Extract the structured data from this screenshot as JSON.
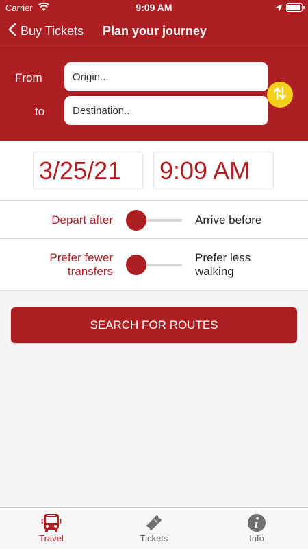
{
  "status_bar": {
    "carrier": "Carrier",
    "time": "9:09 AM"
  },
  "nav": {
    "back_label": "Buy Tickets",
    "title": "Plan your journey"
  },
  "journey": {
    "from_label": "From",
    "to_label": "to",
    "origin_placeholder": "Origin...",
    "destination_placeholder": "Destination..."
  },
  "datetime": {
    "date": "3/25/21",
    "time": "9:09 AM"
  },
  "options": {
    "depart_label": "Depart after",
    "arrive_label": "Arrive before",
    "transfers_label_1": "Prefer fewer",
    "transfers_label_2": "transfers",
    "walking_label_1": "Prefer less",
    "walking_label_2": "walking"
  },
  "search_button_label": "SEARCH FOR ROUTES",
  "tabs": [
    {
      "label": "Travel",
      "icon": "bus-icon",
      "active": true
    },
    {
      "label": "Tickets",
      "icon": "ticket-icon",
      "active": false
    },
    {
      "label": "Info",
      "icon": "info-icon",
      "active": false
    }
  ],
  "colors": {
    "brand": "#ad1f23",
    "swap_accent": "#f4cf1c",
    "background": "#f4f5f4"
  }
}
